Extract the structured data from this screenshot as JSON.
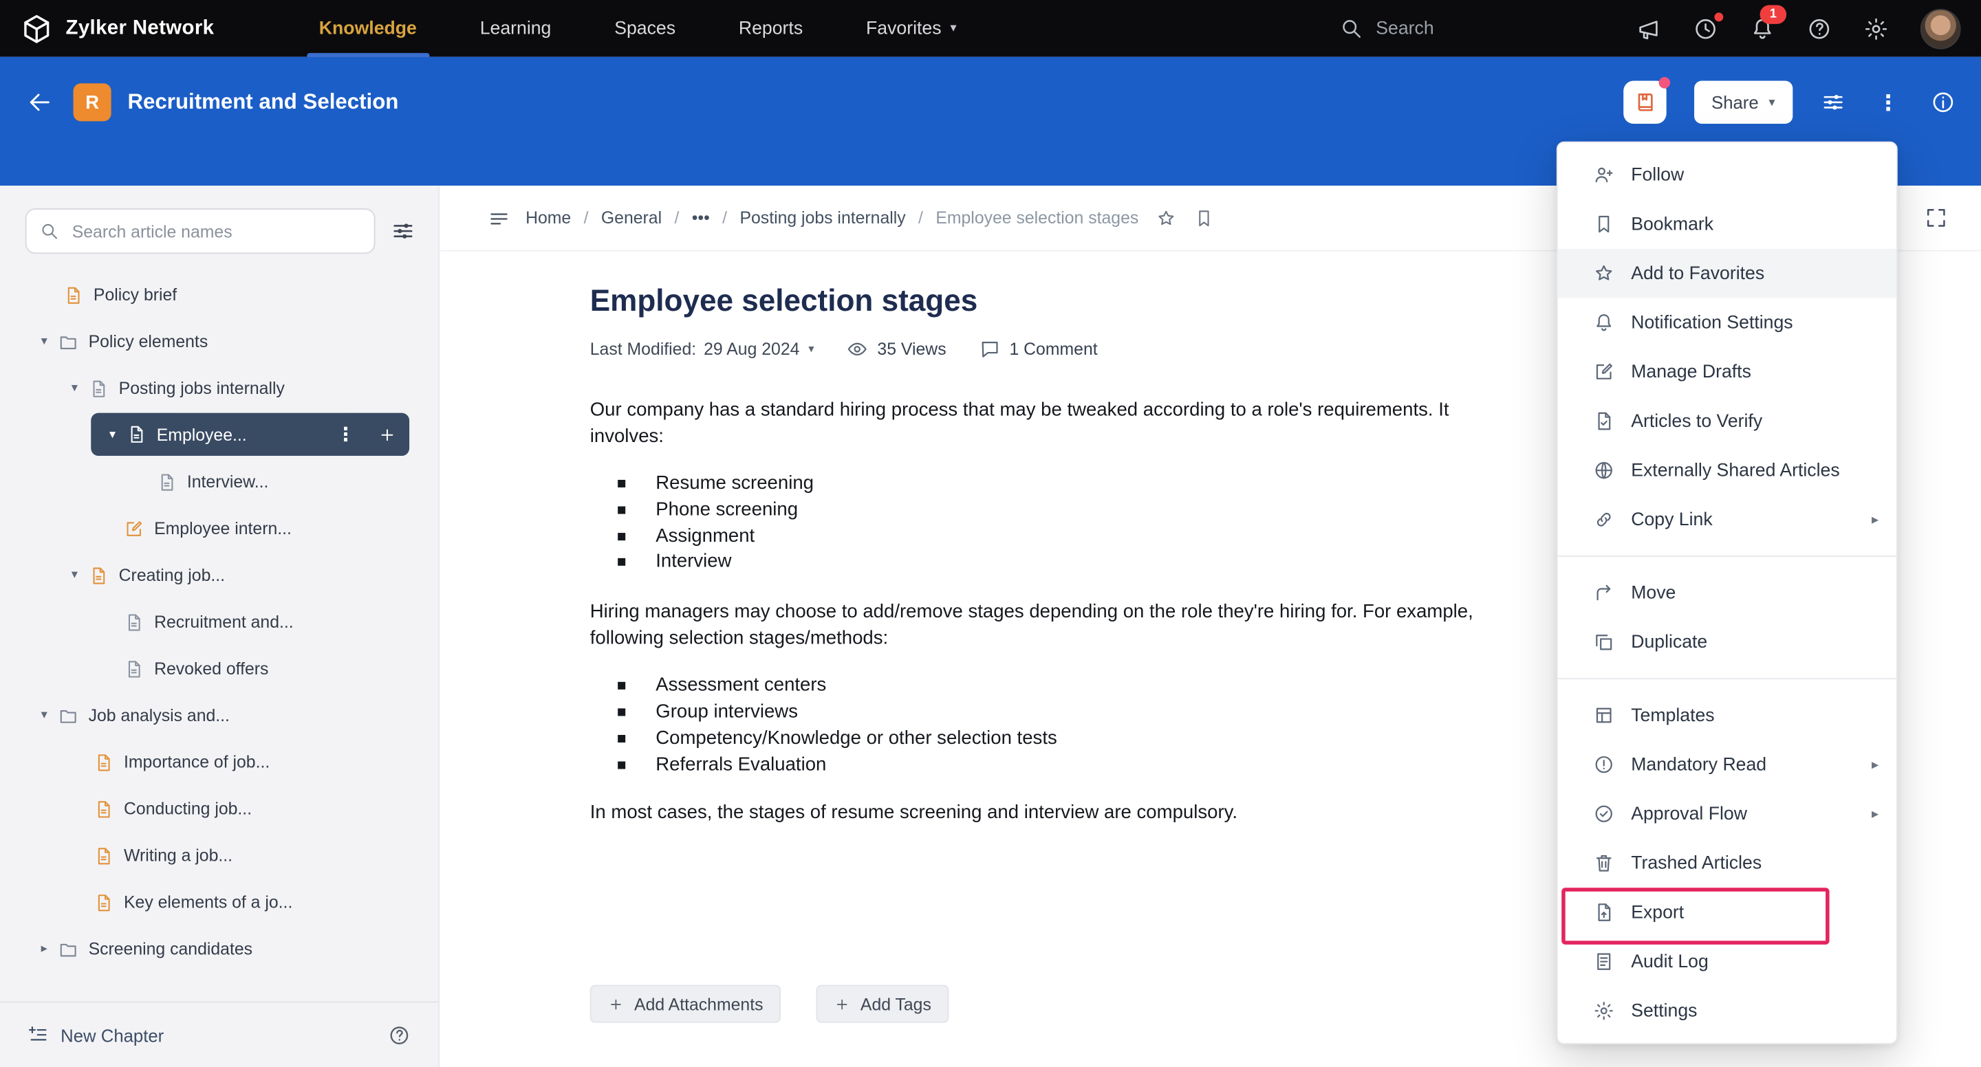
{
  "topnav": {
    "brand": "Zylker Network",
    "tabs": [
      {
        "label": "Knowledge",
        "active": true
      },
      {
        "label": "Learning",
        "active": false
      },
      {
        "label": "Spaces",
        "active": false
      },
      {
        "label": "Reports",
        "active": false
      },
      {
        "label": "Favorites",
        "active": false
      }
    ],
    "search_placeholder": "Search",
    "notification_badge": "1"
  },
  "header": {
    "space_initial": "R",
    "title": "Recruitment and Selection",
    "share_label": "Share"
  },
  "sidebar": {
    "search_placeholder": "Search article names",
    "tree": [
      {
        "label": "Policy brief"
      },
      {
        "label": "Policy elements"
      },
      {
        "label": "Posting jobs internally"
      },
      {
        "label": "Employee..."
      },
      {
        "label": "Interview..."
      },
      {
        "label": "Employee intern..."
      },
      {
        "label": "Creating job..."
      },
      {
        "label": "Recruitment and..."
      },
      {
        "label": "Revoked offers"
      },
      {
        "label": "Job analysis and..."
      },
      {
        "label": "Importance of job..."
      },
      {
        "label": "Conducting job..."
      },
      {
        "label": "Writing a job..."
      },
      {
        "label": "Key elements of a jo..."
      },
      {
        "label": "Screening candidates"
      }
    ],
    "new_chapter_label": "New Chapter"
  },
  "breadcrumb": {
    "separator": "/",
    "items": [
      "Home",
      "General",
      "•••",
      "Posting jobs internally",
      "Employee selection stages"
    ]
  },
  "article": {
    "title": "Employee selection stages",
    "last_modified_label": "Last Modified:",
    "last_modified_value": "29 Aug 2024",
    "views": "35 Views",
    "comments": "1 Comment",
    "p1_lines": [
      "Our company has a standard hiring process that may be tweaked according to a role's requirements. It",
      "involves:"
    ],
    "list1": [
      "Resume screening",
      "Phone screening",
      "Assignment",
      "Interview"
    ],
    "p2_lines": [
      "Hiring managers may choose to add/remove stages depending on the role they're hiring for. For example,",
      "following selection stages/methods:"
    ],
    "list2": [
      "Assessment centers",
      "Group interviews",
      "Competency/Knowledge or other selection tests",
      "Referrals Evaluation"
    ],
    "p3": "In most cases, the stages of resume screening and interview are compulsory.",
    "add_attachments_label": "Add Attachments",
    "add_tags_label": "Add Tags"
  },
  "menu": {
    "items": [
      {
        "label": "Follow"
      },
      {
        "label": "Bookmark"
      },
      {
        "label": "Add to Favorites"
      },
      {
        "label": "Notification Settings"
      },
      {
        "label": "Manage Drafts"
      },
      {
        "label": "Articles to Verify"
      },
      {
        "label": "Externally Shared Articles"
      },
      {
        "label": "Copy Link"
      },
      {
        "label": "Move"
      },
      {
        "label": "Duplicate"
      },
      {
        "label": "Templates"
      },
      {
        "label": "Mandatory Read"
      },
      {
        "label": "Approval Flow"
      },
      {
        "label": "Trashed Articles"
      },
      {
        "label": "Export"
      },
      {
        "label": "Audit Log"
      },
      {
        "label": "Settings"
      }
    ]
  },
  "colors": {
    "top_bar": "#0b0b0d",
    "header_blue": "#1b5ec7",
    "accent_orange": "#ee8b2e",
    "selected_item_bg": "#394a63",
    "annotation_red": "#e3255f",
    "active_tab_text": "#d9a43f",
    "active_tab_underline": "#3a6ed0",
    "badge_red": "#f03e3e"
  }
}
